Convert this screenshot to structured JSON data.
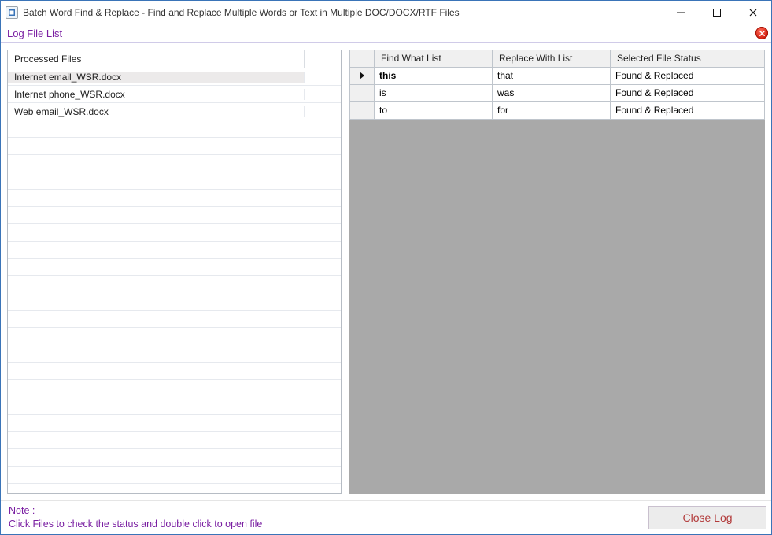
{
  "window": {
    "title": "Batch Word Find & Replace - Find and Replace Multiple Words or Text  in Multiple DOC/DOCX/RTF Files"
  },
  "section": {
    "title": "Log File List"
  },
  "processed": {
    "header": "Processed Files",
    "files": [
      "Internet email_WSR.docx",
      "Internet phone_WSR.docx",
      "Web email_WSR.docx"
    ],
    "selected_index": 0,
    "visible_rows": 25
  },
  "grid": {
    "headers": {
      "find": "Find What List",
      "replace": "Replace With List",
      "status": "Selected File Status"
    },
    "rows": [
      {
        "find": "this",
        "replace": "that",
        "status": "Found & Replaced"
      },
      {
        "find": "is",
        "replace": "was",
        "status": "Found & Replaced"
      },
      {
        "find": "to",
        "replace": "for",
        "status": "Found & Replaced"
      }
    ],
    "current_row_index": 0
  },
  "footer": {
    "note_label": "Note :",
    "note_text": "Click Files to check the status and double click to open file",
    "close_log": "Close Log"
  }
}
